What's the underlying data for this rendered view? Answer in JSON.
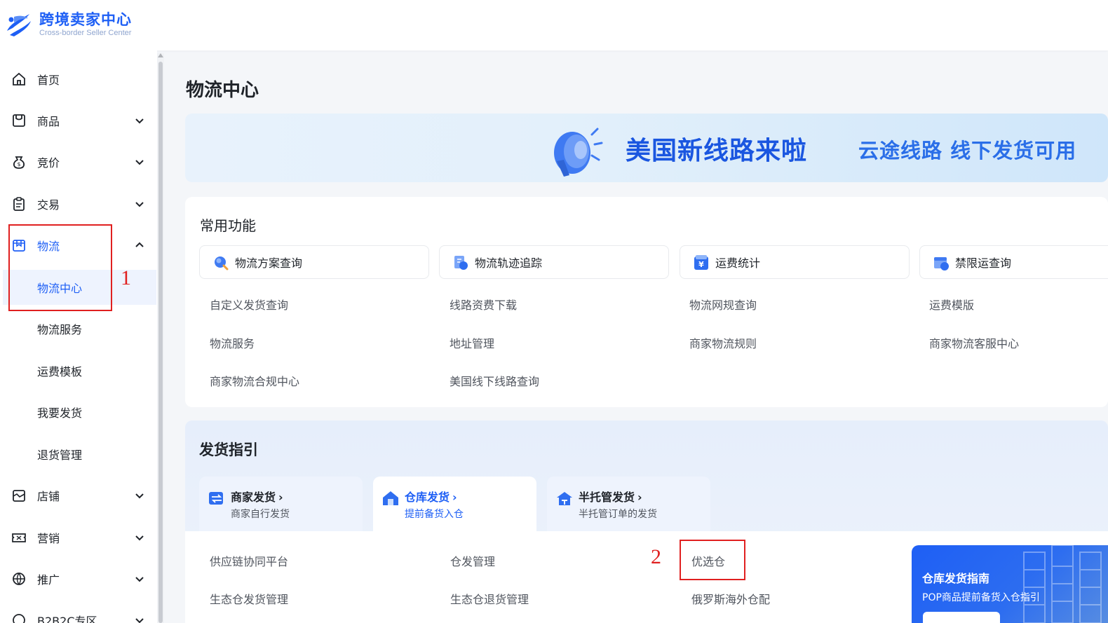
{
  "app": {
    "logo_title": "跨境卖家中心",
    "logo_subtitle": "Cross-border Seller Center",
    "brand_color": "#1e5ff5"
  },
  "sidebar": {
    "items": [
      {
        "label": "首页",
        "icon": "home-icon"
      },
      {
        "label": "商品",
        "icon": "product-icon"
      },
      {
        "label": "竞价",
        "icon": "bidding-icon"
      },
      {
        "label": "交易",
        "icon": "trade-icon"
      },
      {
        "label": "物流",
        "icon": "logistics-icon"
      },
      {
        "label": "店铺",
        "icon": "store-icon"
      },
      {
        "label": "营销",
        "icon": "marketing-icon"
      },
      {
        "label": "推广",
        "icon": "promotion-icon"
      },
      {
        "label": "B2B2C专区",
        "icon": "b2b2c-icon"
      }
    ],
    "logistics_sub": [
      {
        "label": "物流中心"
      },
      {
        "label": "物流服务"
      },
      {
        "label": "运费模板"
      },
      {
        "label": "我要发货"
      },
      {
        "label": "退货管理"
      }
    ]
  },
  "annotations": {
    "one": "1",
    "two": "2",
    "color": "#e02020"
  },
  "main": {
    "page_title": "物流中心",
    "banner": {
      "headline": "美国新线路来啦",
      "subline": "云途线路 线下发货可用"
    },
    "common": {
      "title": "常用功能",
      "buttons": [
        {
          "label": "物流方案查询",
          "icon": "search-icon"
        },
        {
          "label": "物流轨迹追踪",
          "icon": "tracking-icon"
        },
        {
          "label": "运费统计",
          "icon": "yuan-icon"
        },
        {
          "label": "禁限运查询",
          "icon": "restricted-icon"
        }
      ],
      "links": [
        [
          "自定义发货查询",
          "线路资费下载",
          "物流网规查询",
          "运费模版"
        ],
        [
          "物流服务",
          "地址管理",
          "商家物流规则",
          "商家物流客服中心"
        ],
        [
          "商家物流合规中心",
          "美国线下线路查询"
        ]
      ]
    },
    "guide": {
      "title": "发货指引",
      "tabs": [
        {
          "title": "商家发货",
          "sub": "商家自行发货"
        },
        {
          "title": "仓库发货",
          "sub": "提前备货入仓"
        },
        {
          "title": "半托管发货",
          "sub": "半托管订单的发货"
        }
      ],
      "links": [
        [
          "供应链协同平台",
          "仓发管理",
          "优选仓"
        ],
        [
          "生态仓发货管理",
          "生态仓退货管理",
          "俄罗斯海外仓配"
        ]
      ],
      "promo": {
        "title": "仓库发货指南",
        "sub": "POP商品提前备货入仓指引"
      }
    }
  }
}
